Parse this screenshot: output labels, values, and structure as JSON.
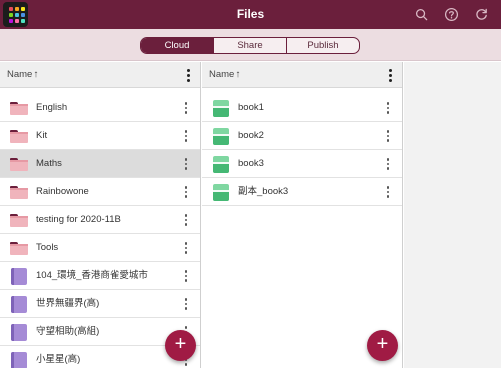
{
  "header": {
    "title": "Files",
    "icons": [
      "apps-grid-icon",
      "search-icon",
      "help-icon",
      "refresh-icon"
    ]
  },
  "tabs": [
    {
      "label": "Cloud",
      "active": true
    },
    {
      "label": "Share",
      "active": false
    },
    {
      "label": "Publish",
      "active": false
    }
  ],
  "left_pane": {
    "column_label": "Name",
    "sort_arrow": "↑",
    "items": [
      {
        "name": "English",
        "type": "folder",
        "selected": false
      },
      {
        "name": "Kit",
        "type": "folder",
        "selected": false
      },
      {
        "name": "Maths",
        "type": "folder",
        "selected": true
      },
      {
        "name": "Rainbowone",
        "type": "folder",
        "selected": false
      },
      {
        "name": "testing for 2020-11B",
        "type": "folder",
        "selected": false
      },
      {
        "name": "Tools",
        "type": "folder",
        "selected": false
      },
      {
        "name": "104_環境_香港商雀愛城市",
        "type": "book",
        "selected": false
      },
      {
        "name": "世界無疆界(高)",
        "type": "book",
        "selected": false
      },
      {
        "name": "守望相助(高組)",
        "type": "book",
        "selected": false
      },
      {
        "name": "小星星(高)",
        "type": "book",
        "selected": false
      }
    ],
    "fab_label": "+"
  },
  "right_pane": {
    "column_label": "Name",
    "sort_arrow": "↑",
    "items": [
      {
        "name": "book1",
        "type": "book"
      },
      {
        "name": "book2",
        "type": "book"
      },
      {
        "name": "book3",
        "type": "book"
      },
      {
        "name": "副本_book3",
        "type": "book"
      }
    ],
    "fab_label": "+"
  },
  "colors": {
    "brand": "#6b1f3c",
    "fab": "#a01b44",
    "folder": "#f0b4bc",
    "book_purple": "#a58bd6",
    "book_green": "#45b874"
  }
}
